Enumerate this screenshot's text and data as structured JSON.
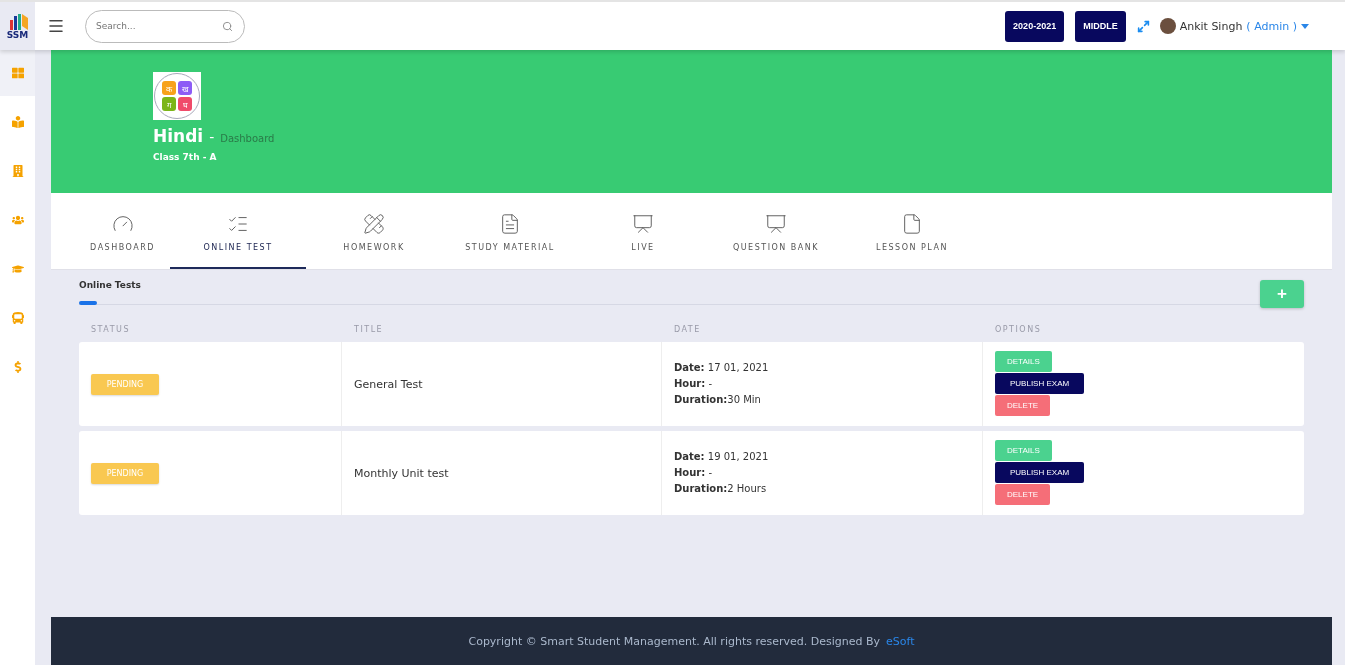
{
  "logo": {
    "text": "SSM"
  },
  "search": {
    "placeholder": "Search..."
  },
  "header": {
    "session": "2020-2021",
    "level": "MIDDLE",
    "user": "Ankit Singh",
    "role": "( Admin )"
  },
  "sidebar": {
    "items": [
      {
        "selected": true
      },
      {
        "selected": false
      },
      {
        "selected": false
      },
      {
        "selected": false
      },
      {
        "selected": false
      },
      {
        "selected": false
      },
      {
        "selected": false
      }
    ]
  },
  "subject": {
    "letters": [
      "क",
      "ख",
      "ग",
      "घ"
    ],
    "name": "Hindi",
    "separator": "-",
    "section": "Dashboard",
    "class": "Class 7th - A"
  },
  "tabs": [
    {
      "label": "DASHBOARD",
      "selected": false
    },
    {
      "label": "ONLINE TEST",
      "selected": true
    },
    {
      "label": "HOMEWORK",
      "selected": false
    },
    {
      "label": "STUDY MATERIAL",
      "selected": false
    },
    {
      "label": "LIVE",
      "selected": false
    },
    {
      "label": "QUESTION BANK",
      "selected": false
    },
    {
      "label": "LESSON PLAN",
      "selected": false
    }
  ],
  "section": {
    "title": "Online Tests",
    "add_button": "+"
  },
  "table": {
    "columns": [
      "STATUS",
      "TITLE",
      "DATE",
      "OPTIONS"
    ],
    "rows": [
      {
        "status": "PENDING",
        "title": "General Test",
        "date_lines": [
          "**Date:** 17 01, 2021",
          "**Hour:** -",
          "**Duration:**30 Min"
        ],
        "actions": [
          {
            "label": "DETAILS",
            "kind": "details"
          },
          {
            "label": "PUBLISH EXAM",
            "kind": "publish"
          },
          {
            "label": "DELETE",
            "kind": "delete"
          }
        ]
      },
      {
        "status": "PENDING",
        "title": "Monthly Unit test",
        "date_lines": [
          "**Date:** 19 01, 2021",
          "**Hour:** -",
          "**Duration:**2 Hours"
        ],
        "actions": [
          {
            "label": "DETAILS",
            "kind": "details"
          },
          {
            "label": "PUBLISH EXAM",
            "kind": "publish"
          },
          {
            "label": "DELETE",
            "kind": "delete"
          }
        ]
      }
    ]
  },
  "footer": {
    "text": "Copyright ©  Smart Student Management. All rights reserved. Designed By",
    "link": "eSoft"
  }
}
